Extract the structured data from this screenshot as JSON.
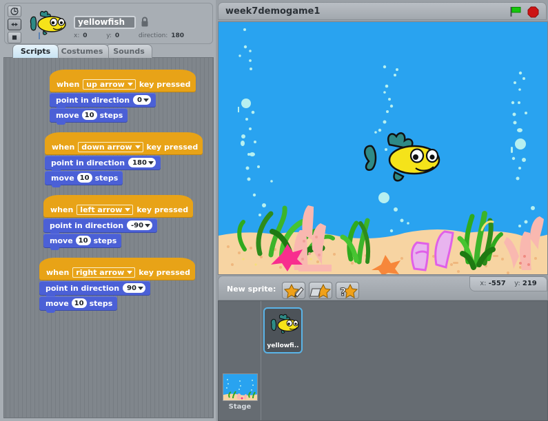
{
  "sprite_header": {
    "name": "yellowfish",
    "x_label": "x:",
    "x_value": "0",
    "y_label": "y:",
    "y_value": "0",
    "direction_label": "direction:",
    "direction_value": "180",
    "rotation_buttons": [
      "rotate-freely",
      "left-right",
      "no-rotate"
    ],
    "lock_icon": "lock-icon"
  },
  "tabs": [
    {
      "label": "Scripts",
      "active": true
    },
    {
      "label": "Costumes",
      "active": false
    },
    {
      "label": "Sounds",
      "active": false
    }
  ],
  "scripts": [
    {
      "hat": {
        "pre": "when",
        "field": "up arrow",
        "post": "key pressed"
      },
      "blocks": [
        {
          "pre": "point in direction",
          "value": "0",
          "kind": "dropdown",
          "post": ""
        },
        {
          "pre": "move",
          "value": "10",
          "kind": "oval",
          "post": "steps"
        }
      ]
    },
    {
      "hat": {
        "pre": "when",
        "field": "down arrow",
        "post": "key pressed"
      },
      "blocks": [
        {
          "pre": "point in direction",
          "value": "180",
          "kind": "dropdown",
          "post": ""
        },
        {
          "pre": "move",
          "value": "10",
          "kind": "oval",
          "post": "steps"
        }
      ]
    },
    {
      "hat": {
        "pre": "when",
        "field": "left arrow",
        "post": "key pressed"
      },
      "blocks": [
        {
          "pre": "point in direction",
          "value": "-90",
          "kind": "dropdown",
          "post": ""
        },
        {
          "pre": "move",
          "value": "10",
          "kind": "oval",
          "post": "steps"
        }
      ]
    },
    {
      "hat": {
        "pre": "when",
        "field": "right arrow",
        "post": "key pressed"
      },
      "blocks": [
        {
          "pre": "point in direction",
          "value": "90",
          "kind": "dropdown",
          "post": ""
        },
        {
          "pre": "move",
          "value": "10",
          "kind": "oval",
          "post": "steps"
        }
      ]
    }
  ],
  "stage": {
    "project_title": "week7demogame1",
    "green_flag_icon": "green-flag-icon",
    "stop_icon": "stop-sign-icon",
    "background_color": "#29a3f0",
    "sand_color": "#f7d4a2"
  },
  "sprite_pane": {
    "new_sprite_label": "New sprite:",
    "buttons": [
      "paint-new-sprite",
      "import-sprite",
      "surprise-sprite"
    ],
    "mouse_x_label": "x:",
    "mouse_x_value": "-557",
    "mouse_y_label": "y:",
    "mouse_y_value": "219",
    "stage_label": "Stage",
    "sprites": [
      {
        "label": "yellowfi..",
        "selected": true
      }
    ]
  },
  "colors": {
    "hat_block": "#e8a317",
    "motion_block": "#4b60d6",
    "selection": "#5ab4e8",
    "panel": "#a8aeb4"
  }
}
